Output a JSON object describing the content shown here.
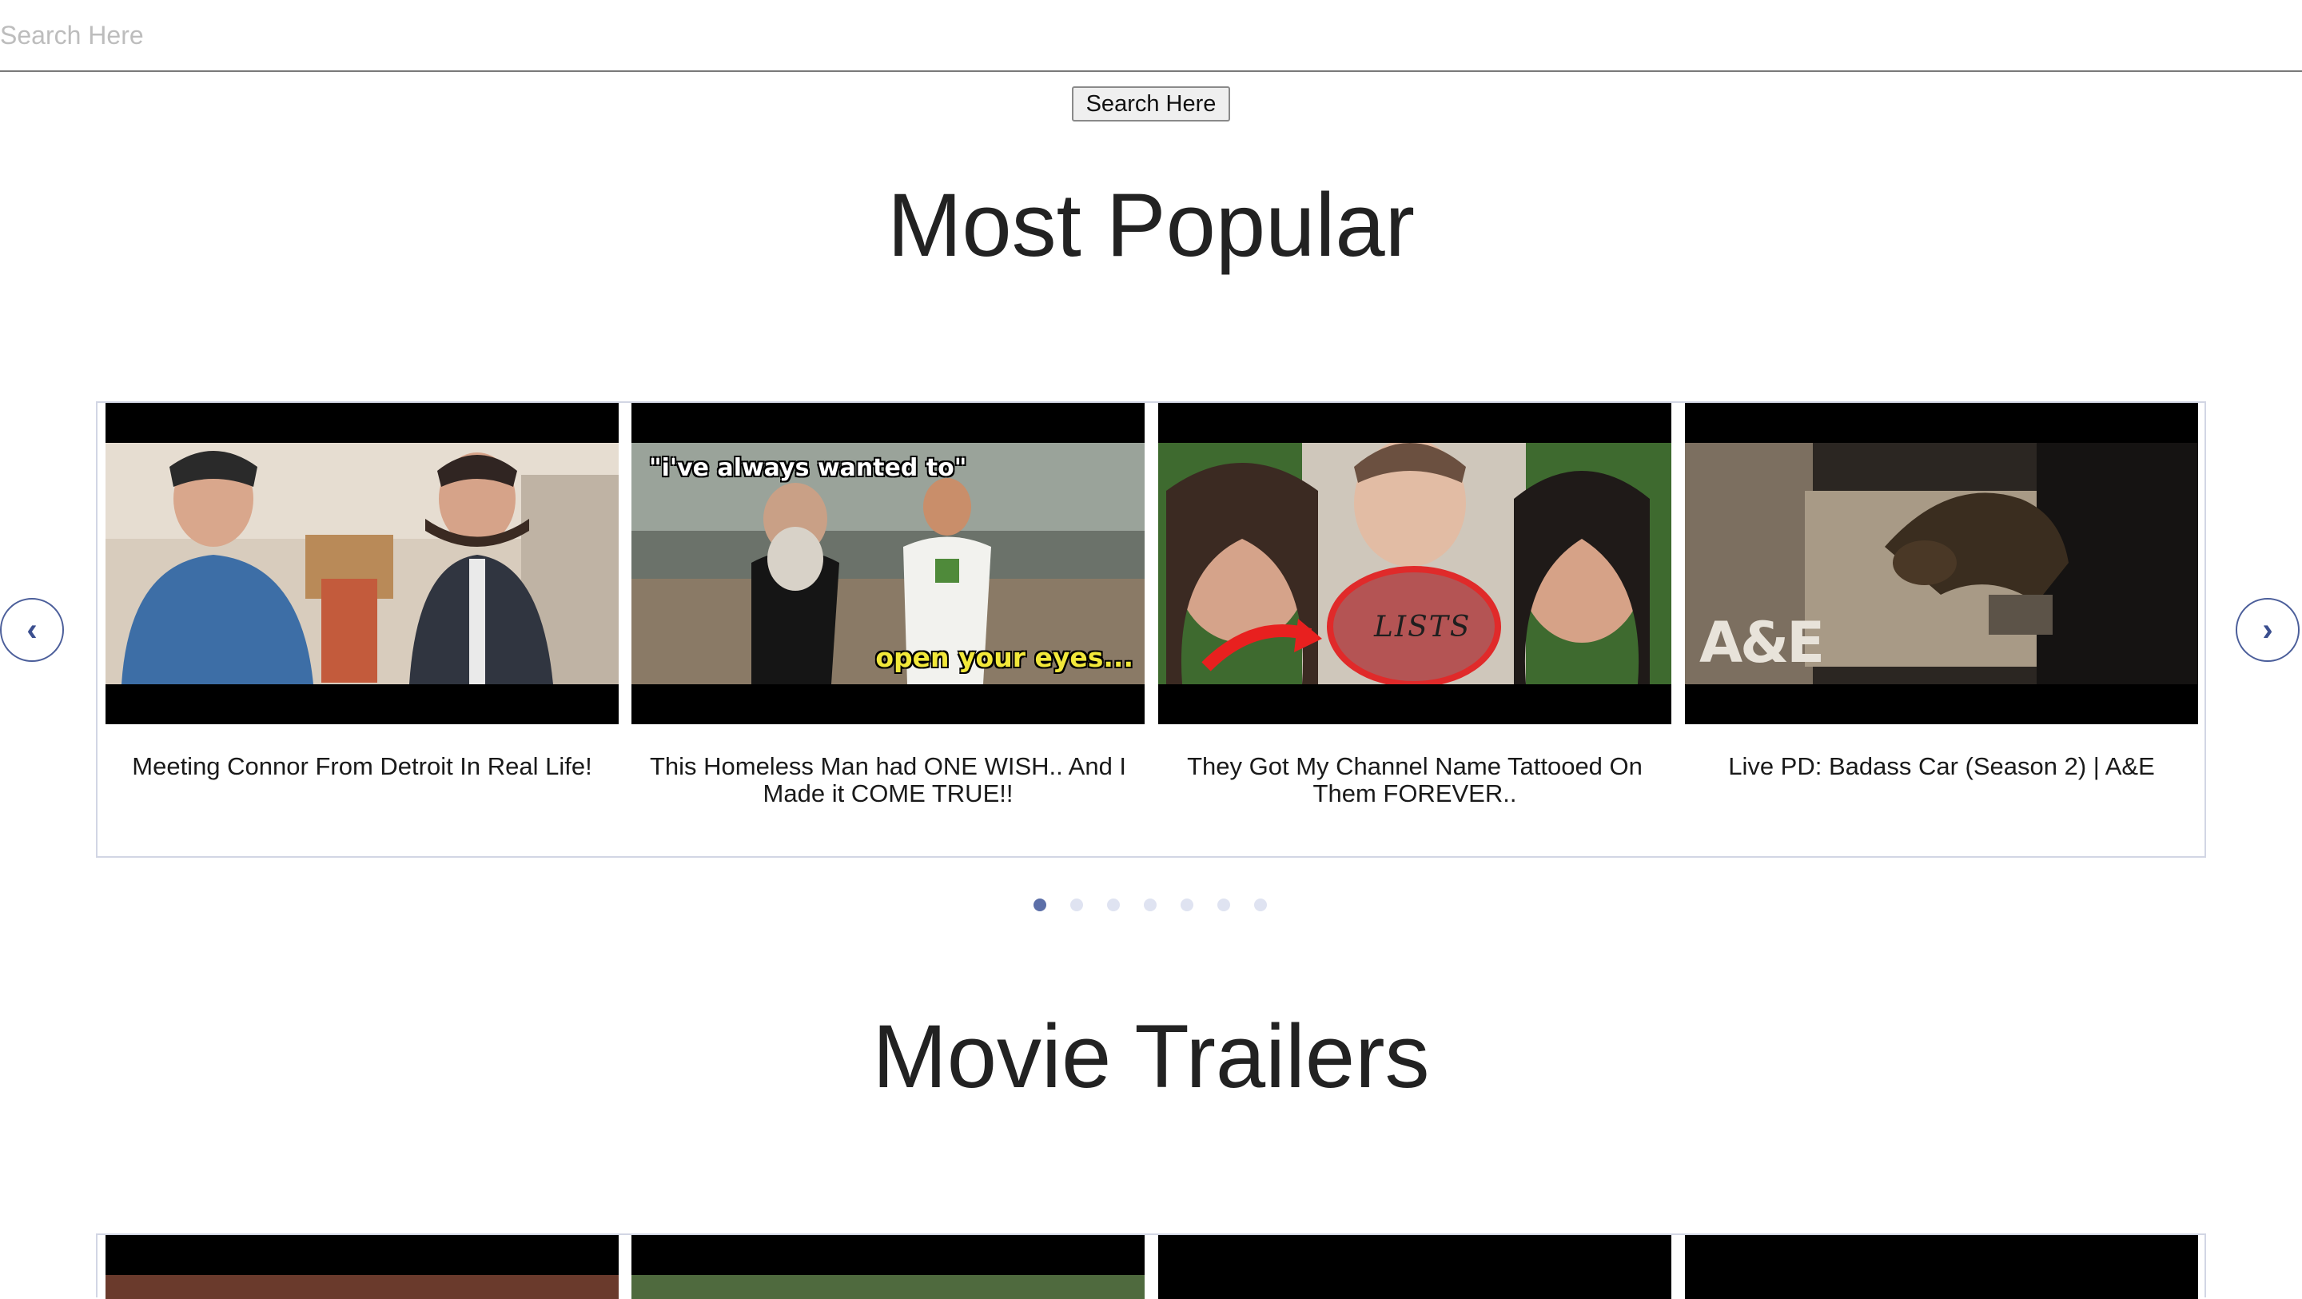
{
  "search": {
    "placeholder": "Search Here",
    "button_label": "Search Here"
  },
  "sections": {
    "popular": {
      "title": "Most Popular",
      "prev_icon": "‹",
      "next_icon": "›",
      "cards": [
        {
          "title": "Meeting Connor From Detroit In Real Life!"
        },
        {
          "title": "This Homeless Man had ONE WISH.. And I Made it COME TRUE!!",
          "overlay_top": "\"i've always wanted to\"",
          "overlay_bottom": "open your eyes..."
        },
        {
          "title": "They Got My Channel Name Tattooed On Them FOREVER..",
          "overlay_logo": "LISTS"
        },
        {
          "title": "Live PD: Badass Car (Season 2) | A&E",
          "overlay_logo": "A&E"
        }
      ],
      "pagination": {
        "count": 7,
        "active_index": 0
      }
    },
    "trailers": {
      "title": "Movie Trailers"
    }
  },
  "colors": {
    "accent": "#4b5e9a",
    "dot_active": "#5c6fa8",
    "dot_inactive": "#dfe3f1",
    "carousel_border": "#d2d6e4"
  }
}
